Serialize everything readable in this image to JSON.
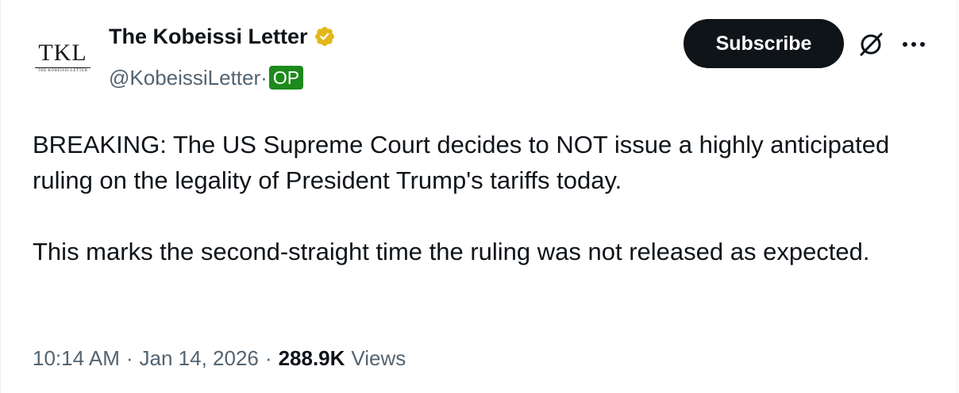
{
  "author": {
    "display_name": "The Kobeissi Letter",
    "handle": "@KobeissiLetter",
    "separator": "·",
    "op_badge": "OP",
    "avatar_mark": "TKL",
    "avatar_subtitle": "THE KOBEISSI LETTER",
    "verified_icon": "verified-badge-gold-icon"
  },
  "actions": {
    "subscribe_label": "Subscribe",
    "grok_icon": "grok-icon",
    "more_icon": "more-options-icon"
  },
  "post": {
    "paragraphs": [
      "BREAKING: The US Supreme Court decides to NOT issue a highly anticipated ruling on the legality of President Trump's tariffs today.",
      "This marks the second-straight time the ruling was not released as expected."
    ]
  },
  "meta": {
    "time": "10:14 AM",
    "date": "Jan 14, 2026",
    "separator": "·",
    "views_count": "288.9K",
    "views_label": "Views"
  },
  "colors": {
    "text_primary": "#0f1419",
    "text_secondary": "#536471",
    "op_badge_bg": "#1c8a1c",
    "verified_gold": "#e2b719",
    "button_bg": "#0f1419"
  }
}
